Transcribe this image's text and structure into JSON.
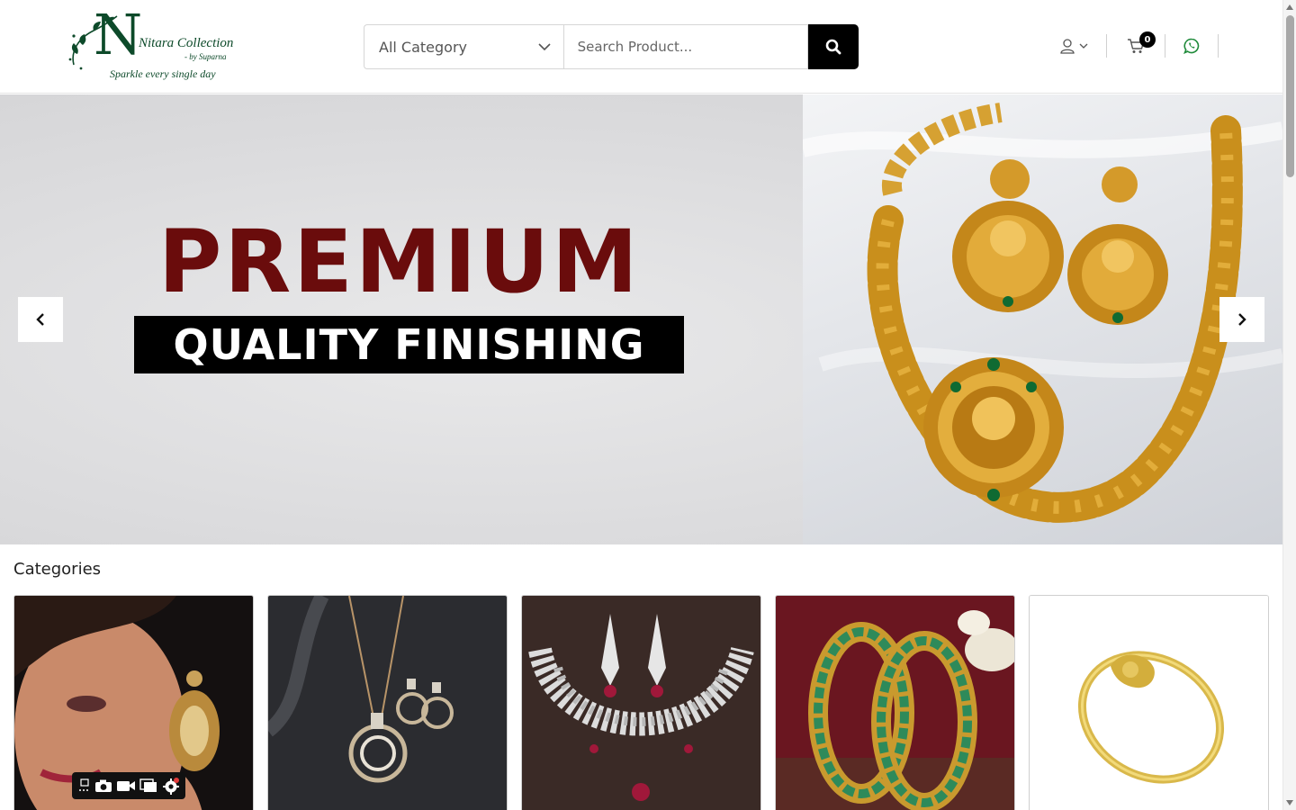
{
  "brand": {
    "name": "Nitara Collection",
    "by": "- by Suparna",
    "tagline": "Sparkle every single day",
    "monogram": "N",
    "color": "#0d4a2a"
  },
  "search": {
    "category_selected": "All Category",
    "placeholder": "Search Product...",
    "button_icon": "search-icon"
  },
  "header_actions": {
    "account_icon": "user-icon",
    "cart_icon": "cart-icon",
    "cart_count": "0",
    "whatsapp_icon": "whatsapp-icon",
    "whatsapp_color": "#1f8a3a"
  },
  "hero": {
    "headline": "PREMIUM",
    "subline": "QUALITY FINISHING",
    "headline_color": "#6a0c0c",
    "prev_icon": "chevron-left-icon",
    "next_icon": "chevron-right-icon"
  },
  "categories": {
    "title": "Categories",
    "items": [
      {
        "image": "earrings-model-photo"
      },
      {
        "image": "diamond-pendant-set-photo"
      },
      {
        "image": "ruby-necklace-set-photo"
      },
      {
        "image": "emerald-bangles-photo"
      },
      {
        "image": "gold-bracelet-photo"
      }
    ]
  },
  "screen_toolbar": {
    "icons": [
      "resize-icon",
      "camera-icon",
      "video-icon",
      "window-icon",
      "gear-icon"
    ]
  }
}
